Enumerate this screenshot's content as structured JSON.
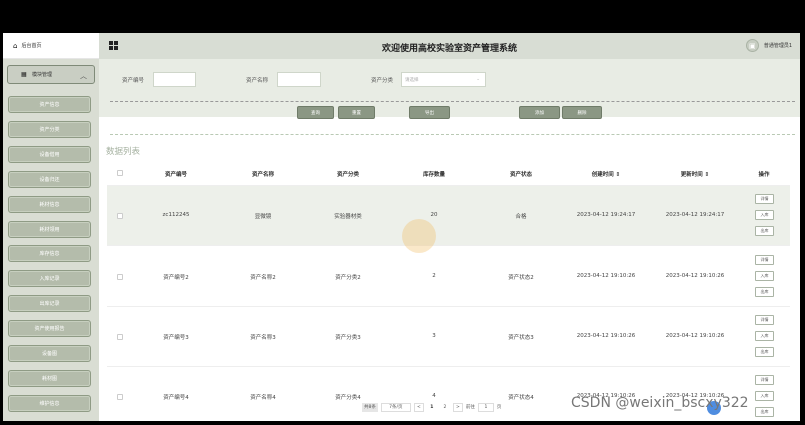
{
  "header": {
    "home_label": "后台首页",
    "title": "欢迎使用高校实验室资产管理系统",
    "user": "普通管理员1"
  },
  "sidebar": {
    "toggle_label": "模块管理",
    "items": [
      "资产信息",
      "资产分类",
      "设备借用",
      "设备归还",
      "耗材信息",
      "耗材领用",
      "库存信息",
      "入库记录",
      "出库记录",
      "资产使用报告",
      "设备图",
      "耗材图",
      "维护信息"
    ]
  },
  "search": {
    "asset_no_label": "资产编号",
    "asset_name_label": "资产名称",
    "asset_cat_label": "资产分类",
    "asset_cat_placeholder": "请选择",
    "buttons": {
      "query": "查询",
      "reset": "重置",
      "export": "导出",
      "add": "添加",
      "delete": "删除"
    }
  },
  "list_title": "数据列表",
  "table": {
    "headers": [
      "资产编号",
      "资产名称",
      "资产分类",
      "库存数量",
      "资产状态",
      "创建时间 ⇕",
      "更新时间 ⇕",
      "操作"
    ],
    "rows": [
      [
        "zc112245",
        "显微镜",
        "实验器材类",
        "20",
        "合格",
        "2023-04-12 19:24:17",
        "2023-04-12 19:24:17"
      ],
      [
        "资产编号2",
        "资产名称2",
        "资产分类2",
        "2",
        "资产状态2",
        "2023-04-12 19:10:26",
        "2023-04-12 19:10:26"
      ],
      [
        "资产编号3",
        "资产名称3",
        "资产分类3",
        "3",
        "资产状态3",
        "2023-04-12 19:10:26",
        "2023-04-12 19:10:26"
      ],
      [
        "资产编号4",
        "资产名称4",
        "资产分类4",
        "4",
        "资产状态4",
        "2023-04-12 19:10:26",
        "2023-04-12 19:10:26"
      ]
    ],
    "op_labels": [
      "详情",
      "入库",
      "出库"
    ]
  },
  "pager": {
    "total": "共8条",
    "per_page": "7条/页",
    "prev": "<",
    "page1": "1",
    "page2": "2",
    "next": ">",
    "goto": "前往",
    "goto_value": "1",
    "unit": "页"
  },
  "watermark": "CSDN @weixin_bscxy322",
  "colors": {
    "accent": "#8b9784",
    "sidebar_bg": "#d9ddd3",
    "header_bg": "#d8ddd4"
  }
}
